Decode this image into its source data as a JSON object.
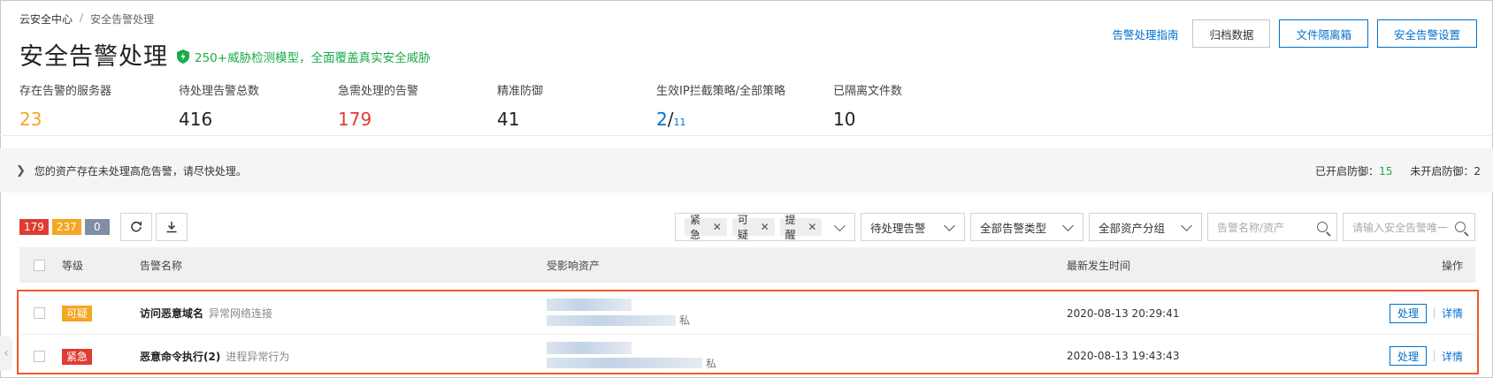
{
  "breadcrumb": {
    "root": "云安全中心",
    "sep": "/",
    "current": "安全告警处理"
  },
  "page": {
    "title": "安全告警处理",
    "slogan": "250+威胁检测模型，全面覆盖真实安全威胁"
  },
  "header": {
    "guide_link": "告警处理指南",
    "archive": "归档数据",
    "quarantine": "文件隔离箱",
    "settings": "安全告警设置"
  },
  "stats": [
    {
      "label": "存在告警的服务器",
      "value": "23"
    },
    {
      "label": "待处理告警总数",
      "value": "416"
    },
    {
      "label": "急需处理的告警",
      "value": "179"
    },
    {
      "label": "精准防御",
      "value": "41"
    },
    {
      "label": "生效IP拦截策略/全部策略",
      "value": "2",
      "slash": "/",
      "total": "11"
    },
    {
      "label": "已隔离文件数",
      "value": "10"
    }
  ],
  "notice": {
    "text": "您的资产存在未处理高危告警，请尽快处理。",
    "enabled_label": "已开启防御：",
    "enabled_value": "15",
    "disabled_label": "未开启防御：",
    "disabled_value": "2"
  },
  "counts": {
    "red": "179",
    "orange": "237",
    "grey": "0"
  },
  "filters": {
    "tags": [
      "紧急",
      "可疑",
      "提醒"
    ],
    "status": "待处理告警",
    "type": "全部告警类型",
    "group": "全部资产分组",
    "search1_placeholder": "告警名称/资产",
    "search2_placeholder": "请输入安全告警唯一"
  },
  "table": {
    "headers": {
      "level": "等级",
      "name": "告警名称",
      "asset": "受影响资产",
      "time": "最新发生时间",
      "op": "操作"
    },
    "rows": [
      {
        "level": "可疑",
        "name": "访问恶意域名",
        "sub": "异常网络连接",
        "asset_suffix": "私",
        "time": "2020-08-13 20:29:41",
        "handle": "处理",
        "detail": "详情"
      },
      {
        "level": "紧急",
        "name": "恶意命令执行(2)",
        "sub": "进程异常行为",
        "asset_suffix": "私",
        "time": "2020-08-13 19:43:43",
        "handle": "处理",
        "detail": "详情"
      }
    ]
  },
  "colors": {
    "accent": "#0070cc",
    "urgent": "#e03c31",
    "suspicious": "#f5a623",
    "safe": "#1aab4b",
    "highlight": "#f05a28"
  }
}
